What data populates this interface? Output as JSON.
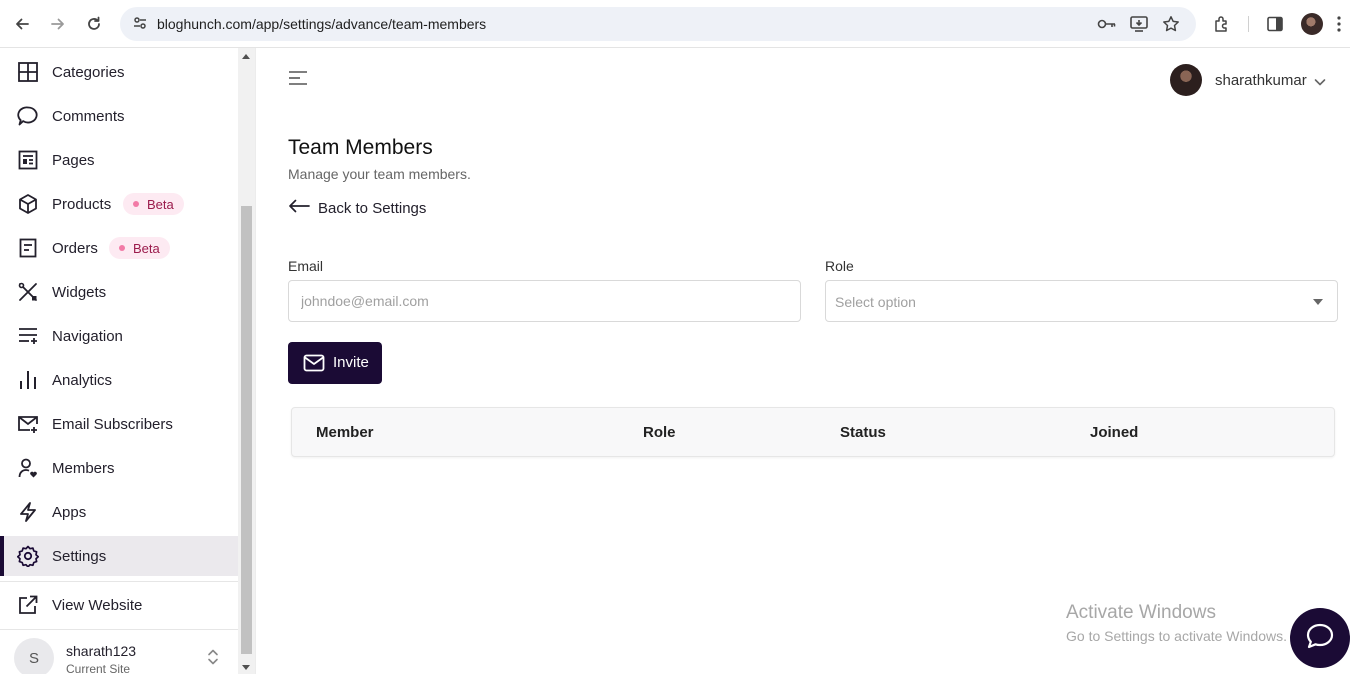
{
  "browser": {
    "url": "bloghunch.com/app/settings/advance/team-members"
  },
  "sidebar": {
    "items": [
      {
        "label": "Categories",
        "icon": "grid-icon"
      },
      {
        "label": "Comments",
        "icon": "comment-icon"
      },
      {
        "label": "Pages",
        "icon": "pages-icon"
      },
      {
        "label": "Products",
        "icon": "cube-icon",
        "badge": "Beta"
      },
      {
        "label": "Orders",
        "icon": "orders-icon",
        "badge": "Beta"
      },
      {
        "label": "Widgets",
        "icon": "tools-icon"
      },
      {
        "label": "Navigation",
        "icon": "navigation-icon"
      },
      {
        "label": "Analytics",
        "icon": "analytics-icon"
      },
      {
        "label": "Email Subscribers",
        "icon": "mail-plus-icon"
      },
      {
        "label": "Members",
        "icon": "member-heart-icon"
      },
      {
        "label": "Apps",
        "icon": "bolt-icon"
      },
      {
        "label": "Settings",
        "icon": "gear-icon",
        "active": true
      }
    ],
    "view_website": "View Website",
    "site": {
      "initial": "S",
      "name": "sharath123",
      "subtitle": "Current Site"
    }
  },
  "header": {
    "username": "sharathkumar"
  },
  "page": {
    "title": "Team Members",
    "subtitle": "Manage your team members.",
    "back_label": "Back to Settings"
  },
  "form": {
    "email_label": "Email",
    "email_placeholder": "johndoe@email.com",
    "email_value": "",
    "role_label": "Role",
    "role_placeholder": "Select option",
    "invite_label": "Invite"
  },
  "table": {
    "columns": [
      "Member",
      "Role",
      "Status",
      "Joined"
    ]
  },
  "watermark": {
    "title": "Activate Windows",
    "subtitle": "Go to Settings to activate Windows."
  },
  "colors": {
    "accent": "#1b0b35",
    "badge_bg": "#fdeaf2",
    "badge_text": "#9b1b4c"
  }
}
